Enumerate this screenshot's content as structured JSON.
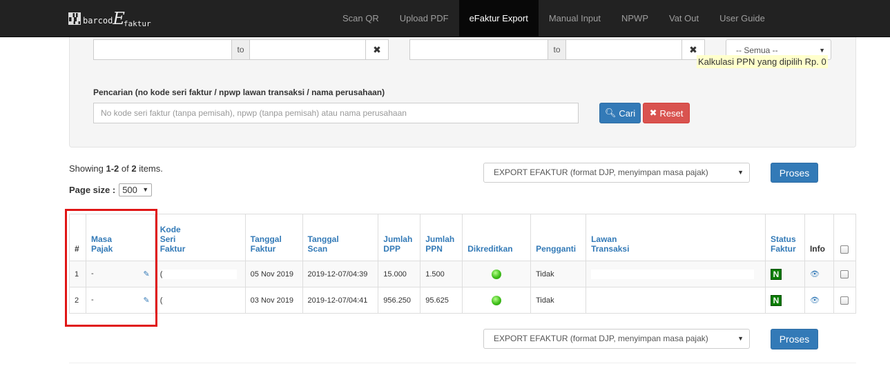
{
  "brand": {
    "prefix": "barcod",
    "big": "E",
    "suffix": "faktur"
  },
  "nav": [
    {
      "label": "Scan QR",
      "active": false
    },
    {
      "label": "Upload PDF",
      "active": false
    },
    {
      "label": "eFaktur Export",
      "active": true
    },
    {
      "label": "Manual Input",
      "active": false
    },
    {
      "label": "NPWP",
      "active": false
    },
    {
      "label": "Vat Out",
      "active": false
    },
    {
      "label": "User Guide",
      "active": false
    }
  ],
  "filters": {
    "to_label": "to",
    "clear_icon": "✖",
    "status_select": "-- Semua --",
    "kalkulasi": "Kalkulasi PPN yang dipilih Rp. 0",
    "search_label": "Pencarian (no kode seri faktur / npwp lawan transaksi / nama perusahaan)",
    "search_placeholder": "No kode seri faktur (tanpa pemisah), npwp (tanpa pemisah) atau nama perusahaan",
    "cari_label": "Cari",
    "reset_label": "Reset"
  },
  "summary": {
    "showing": "Showing ",
    "range": "1-2",
    "of": " of ",
    "total": "2",
    "items": " items."
  },
  "page_size": {
    "label": "Page size :",
    "value": "500"
  },
  "export": {
    "select_value": "EXPORT EFAKTUR (format DJP, menyimpan masa pajak)",
    "proses_label": "Proses"
  },
  "table": {
    "headers": {
      "num": "#",
      "masa_pajak": [
        "Masa",
        "Pajak"
      ],
      "kode_seri": [
        "Kode",
        "Seri",
        "Faktur"
      ],
      "tanggal_faktur": [
        "Tanggal",
        "Faktur"
      ],
      "tanggal_scan": [
        "Tanggal",
        "Scan"
      ],
      "jumlah_dpp": [
        "Jumlah",
        "DPP"
      ],
      "jumlah_ppn": [
        "Jumlah",
        "PPN"
      ],
      "dikreditkan": "Dikreditkan",
      "pengganti": "Pengganti",
      "lawan_transaksi": [
        "Lawan",
        "Transaksi"
      ],
      "status_faktur": [
        "Status",
        "Faktur"
      ],
      "info": "Info"
    },
    "rows": [
      {
        "num": "1",
        "masa_pajak": "-",
        "kode_seri": "(",
        "tanggal_faktur": "05 Nov 2019",
        "tanggal_scan": "2019-12-07/04:39",
        "jumlah_dpp": "15.000",
        "jumlah_ppn": "1.500",
        "dikreditkan": "green",
        "pengganti": "Tidak",
        "lawan_transaksi": "",
        "status_faktur": "N"
      },
      {
        "num": "2",
        "masa_pajak": "-",
        "kode_seri": "(",
        "tanggal_faktur": "03 Nov 2019",
        "tanggal_scan": "2019-12-07/04:41",
        "jumlah_dpp": "956.250",
        "jumlah_ppn": "95.625",
        "dikreditkan": "green",
        "pengganti": "Tidak",
        "lawan_transaksi": "",
        "status_faktur": "N"
      }
    ]
  },
  "icons": {
    "edit": "edit-icon",
    "eye": "eye-icon",
    "search": "search-icon",
    "reset": "times-icon"
  },
  "colors": {
    "navbar": "#222222",
    "primary": "#337ab7",
    "danger": "#d9534f",
    "highlight": "#e01616",
    "status_n": "#0a7d00"
  }
}
